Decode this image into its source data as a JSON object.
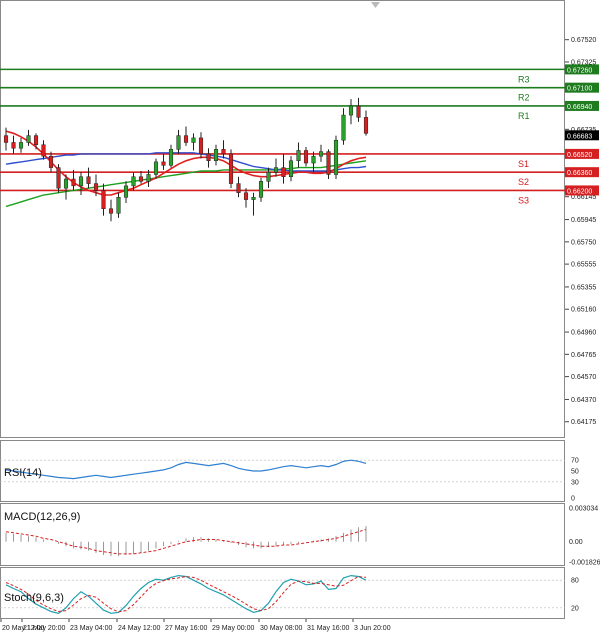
{
  "chart_data": {
    "type": "candlestick",
    "instrument": "",
    "price_axis": {
      "ylim": [
        0.6405,
        0.6785
      ],
      "ticks": [
        "0.67520",
        "0.67325",
        "0.66735",
        "0.66145",
        "0.65945",
        "0.65750",
        "0.65555",
        "0.65355",
        "0.65160",
        "0.64960",
        "0.64765",
        "0.64570",
        "0.64370",
        "0.64175"
      ],
      "current_price": "0.66683"
    },
    "levels": [
      {
        "name": "R3",
        "value": 0.6726,
        "value_label": "0.67260",
        "color": "#1e7b1e"
      },
      {
        "name": "R2",
        "value": 0.671,
        "value_label": "0.67100",
        "color": "#1e7b1e"
      },
      {
        "name": "R1",
        "value": 0.6694,
        "value_label": "0.66940",
        "color": "#1e7b1e"
      },
      {
        "name": "S1",
        "value": 0.6652,
        "value_label": "0.66520",
        "color": "#d42020"
      },
      {
        "name": "S2",
        "value": 0.6636,
        "value_label": "0.66360",
        "color": "#d42020"
      },
      {
        "name": "S3",
        "value": 0.662,
        "value_label": "0.66200",
        "color": "#d42020"
      }
    ],
    "x_labels": [
      "20 May 12:00",
      "21 May 20:00",
      "23 May 04:00",
      "24 May 12:00",
      "27 May 16:00",
      "29 May 00:00",
      "30 May 08:00",
      "31 May 16:00",
      "3 Jun 20:00"
    ],
    "candles": [
      [
        0.6668,
        0.6675,
        0.6655,
        0.6662
      ],
      [
        0.6662,
        0.6668,
        0.6652,
        0.6657
      ],
      [
        0.6657,
        0.6666,
        0.6653,
        0.6662
      ],
      [
        0.6662,
        0.6673,
        0.6659,
        0.6668
      ],
      [
        0.6668,
        0.667,
        0.6656,
        0.666
      ],
      [
        0.666,
        0.6664,
        0.6647,
        0.665
      ],
      [
        0.665,
        0.6654,
        0.6636,
        0.664
      ],
      [
        0.664,
        0.6643,
        0.6618,
        0.6622
      ],
      [
        0.6622,
        0.6634,
        0.6612,
        0.663
      ],
      [
        0.663,
        0.6638,
        0.662,
        0.6624
      ],
      [
        0.6624,
        0.6636,
        0.6616,
        0.6632
      ],
      [
        0.6632,
        0.664,
        0.6622,
        0.6626
      ],
      [
        0.6626,
        0.6634,
        0.6615,
        0.662
      ],
      [
        0.662,
        0.6626,
        0.6598,
        0.6604
      ],
      [
        0.6604,
        0.6612,
        0.6593,
        0.66
      ],
      [
        0.66,
        0.6618,
        0.6596,
        0.6614
      ],
      [
        0.6614,
        0.6628,
        0.6609,
        0.6624
      ],
      [
        0.6624,
        0.6636,
        0.662,
        0.6632
      ],
      [
        0.6632,
        0.6637,
        0.6626,
        0.6628
      ],
      [
        0.6628,
        0.6638,
        0.6623,
        0.6634
      ],
      [
        0.6634,
        0.6648,
        0.663,
        0.6645
      ],
      [
        0.6645,
        0.6652,
        0.6638,
        0.6642
      ],
      [
        0.6642,
        0.666,
        0.664,
        0.6656
      ],
      [
        0.6656,
        0.6673,
        0.6652,
        0.6668
      ],
      [
        0.6668,
        0.6676,
        0.6659,
        0.6662
      ],
      [
        0.6662,
        0.667,
        0.6655,
        0.6666
      ],
      [
        0.6666,
        0.6671,
        0.6648,
        0.6652
      ],
      [
        0.6652,
        0.6657,
        0.664,
        0.6646
      ],
      [
        0.6646,
        0.666,
        0.6642,
        0.6656
      ],
      [
        0.6656,
        0.6664,
        0.6648,
        0.6652
      ],
      [
        0.6652,
        0.6656,
        0.6622,
        0.6626
      ],
      [
        0.6626,
        0.6632,
        0.6614,
        0.6618
      ],
      [
        0.6618,
        0.6622,
        0.6605,
        0.6612
      ],
      [
        0.6612,
        0.6618,
        0.6598,
        0.6614
      ],
      [
        0.6614,
        0.6631,
        0.661,
        0.6628
      ],
      [
        0.6628,
        0.664,
        0.6622,
        0.6636
      ],
      [
        0.6636,
        0.6648,
        0.6632,
        0.664
      ],
      [
        0.664,
        0.6652,
        0.6626,
        0.6632
      ],
      [
        0.6632,
        0.665,
        0.6628,
        0.6646
      ],
      [
        0.6646,
        0.6662,
        0.664,
        0.6655
      ],
      [
        0.6655,
        0.6658,
        0.6641,
        0.6644
      ],
      [
        0.6644,
        0.6654,
        0.6636,
        0.665
      ],
      [
        0.665,
        0.666,
        0.6645,
        0.6654
      ],
      [
        0.6654,
        0.6656,
        0.663,
        0.6634
      ],
      [
        0.6634,
        0.6668,
        0.663,
        0.6664
      ],
      [
        0.6664,
        0.6692,
        0.666,
        0.6686
      ],
      [
        0.6686,
        0.67,
        0.6678,
        0.6694
      ],
      [
        0.6694,
        0.6701,
        0.668,
        0.6684
      ],
      [
        0.6684,
        0.669,
        0.6668,
        0.667
      ]
    ],
    "ma_red": [
      0.6672,
      0.667,
      0.6667,
      0.6663,
      0.6658,
      0.6652,
      0.6645,
      0.6638,
      0.6632,
      0.6627,
      0.6623,
      0.662,
      0.6618,
      0.6616,
      0.6616,
      0.6618,
      0.662,
      0.6622,
      0.6625,
      0.6628,
      0.6631,
      0.6635,
      0.6639,
      0.6643,
      0.6646,
      0.6648,
      0.6649,
      0.6649,
      0.6648,
      0.6646,
      0.6642,
      0.6638,
      0.6635,
      0.6633,
      0.6632,
      0.6632,
      0.6633,
      0.6634,
      0.6635,
      0.6636,
      0.6636,
      0.6635,
      0.6635,
      0.6636,
      0.6639,
      0.6643,
      0.6646,
      0.6648,
      0.6649
    ],
    "ma_blue": [
      0.6643,
      0.6644,
      0.6645,
      0.6646,
      0.6647,
      0.6648,
      0.6649,
      0.665,
      0.6651,
      0.6651,
      0.6652,
      0.6652,
      0.6652,
      0.6652,
      0.6652,
      0.6652,
      0.6652,
      0.6652,
      0.6652,
      0.6652,
      0.6653,
      0.6653,
      0.6653,
      0.6653,
      0.6653,
      0.6653,
      0.6652,
      0.6651,
      0.665,
      0.6649,
      0.6647,
      0.6645,
      0.6643,
      0.6641,
      0.664,
      0.6639,
      0.6638,
      0.6638,
      0.6637,
      0.6637,
      0.6637,
      0.6637,
      0.6637,
      0.6637,
      0.6638,
      0.6639,
      0.664,
      0.664,
      0.6641
    ],
    "ma_green": [
      0.6606,
      0.6608,
      0.661,
      0.6612,
      0.6614,
      0.6616,
      0.6617,
      0.6618,
      0.6619,
      0.662,
      0.6621,
      0.6622,
      0.6623,
      0.6624,
      0.6625,
      0.6626,
      0.6627,
      0.6628,
      0.6629,
      0.663,
      0.6631,
      0.6632,
      0.6633,
      0.6634,
      0.6635,
      0.6636,
      0.6637,
      0.6637,
      0.6637,
      0.6638,
      0.6638,
      0.6638,
      0.6638,
      0.6638,
      0.6638,
      0.6638,
      0.6638,
      0.6639,
      0.6639,
      0.664,
      0.664,
      0.664,
      0.664,
      0.6641,
      0.6642,
      0.6643,
      0.6644,
      0.6645,
      0.6646
    ],
    "rsi": {
      "label": "RSI(14)",
      "ticks": [
        "70",
        "50",
        "30",
        "0"
      ],
      "values": [
        52,
        50,
        48,
        46,
        44,
        42,
        40,
        38,
        37,
        36,
        38,
        40,
        42,
        40,
        38,
        40,
        42,
        44,
        46,
        48,
        50,
        52,
        56,
        62,
        66,
        64,
        62,
        60,
        62,
        64,
        60,
        55,
        52,
        50,
        50,
        52,
        55,
        58,
        60,
        58,
        56,
        58,
        60,
        58,
        62,
        68,
        70,
        68,
        64
      ]
    },
    "macd": {
      "label": "MACD(12,26,9)",
      "ticks": [
        "0.003034",
        "0.00",
        "-0.001826"
      ],
      "hist": [
        0.0008,
        0.0007,
        0.0006,
        0.0005,
        0.0004,
        0.0002,
        0.0,
        -0.0002,
        -0.0004,
        -0.0006,
        -0.0007,
        -0.0008,
        -0.001,
        -0.0012,
        -0.0013,
        -0.0013,
        -0.0012,
        -0.0011,
        -0.001,
        -0.0008,
        -0.0006,
        -0.0004,
        -0.0002,
        0.0001,
        0.0003,
        0.0004,
        0.0004,
        0.0003,
        0.0002,
        0.0001,
        -0.0001,
        -0.0003,
        -0.0005,
        -0.0006,
        -0.0006,
        -0.0005,
        -0.0004,
        -0.0003,
        -0.0002,
        -0.0001,
        0.0,
        0.0001,
        0.0002,
        0.0003,
        0.0005,
        0.0008,
        0.0011,
        0.0013,
        0.0014
      ],
      "signal": [
        0.0009,
        0.0008,
        0.0007,
        0.0006,
        0.0005,
        0.0003,
        0.0002,
        0.0,
        -0.0002,
        -0.0004,
        -0.0005,
        -0.0006,
        -0.0008,
        -0.0009,
        -0.001,
        -0.0011,
        -0.0011,
        -0.0011,
        -0.001,
        -0.0009,
        -0.0008,
        -0.0006,
        -0.0004,
        -0.0002,
        0.0,
        0.0001,
        0.0002,
        0.0002,
        0.0002,
        0.0001,
        0.0,
        -0.0001,
        -0.0002,
        -0.0003,
        -0.0004,
        -0.0004,
        -0.0004,
        -0.0003,
        -0.0003,
        -0.0002,
        -0.0001,
        0.0,
        0.0001,
        0.0002,
        0.0003,
        0.0005,
        0.0007,
        0.0009,
        0.0011
      ]
    },
    "stoch": {
      "label": "Stoch(9,6,3)",
      "ticks": [
        "80",
        "20"
      ],
      "k": [
        70,
        62,
        55,
        40,
        28,
        20,
        12,
        8,
        20,
        40,
        55,
        45,
        30,
        15,
        8,
        10,
        25,
        45,
        62,
        75,
        82,
        80,
        86,
        90,
        88,
        80,
        72,
        62,
        55,
        48,
        38,
        28,
        18,
        10,
        14,
        30,
        55,
        75,
        82,
        78,
        70,
        72,
        78,
        60,
        62,
        85,
        90,
        88,
        80
      ],
      "d": [
        75,
        68,
        60,
        50,
        36,
        26,
        18,
        12,
        14,
        26,
        40,
        47,
        43,
        30,
        18,
        11,
        14,
        27,
        44,
        61,
        73,
        79,
        83,
        85,
        88,
        86,
        80,
        71,
        63,
        55,
        47,
        38,
        28,
        18,
        14,
        18,
        33,
        53,
        71,
        78,
        77,
        73,
        73,
        70,
        67,
        69,
        79,
        88,
        86
      ]
    }
  }
}
